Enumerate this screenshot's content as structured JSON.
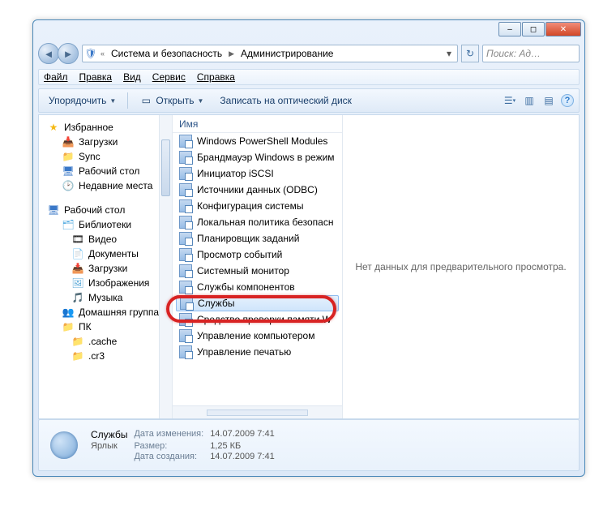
{
  "titlebar": {
    "min": "–",
    "max": "◻",
    "close": "✕"
  },
  "address": {
    "crumb1": "Система и безопасность",
    "crumb2": "Администрирование",
    "search_placeholder": "Поиск: Ад…"
  },
  "menu": {
    "file": "Файл",
    "edit": "Правка",
    "view": "Вид",
    "tools": "Сервис",
    "help": "Справка"
  },
  "toolbar": {
    "organize": "Упорядочить",
    "open": "Открыть",
    "burn": "Записать на оптический диск"
  },
  "nav": {
    "favorites": "Избранное",
    "fav_items": [
      "Загрузки",
      "Sync",
      "Рабочий стол",
      "Недавние места"
    ],
    "desktop": "Рабочий стол",
    "libraries": "Библиотеки",
    "lib_items": [
      "Видео",
      "Документы",
      "Загрузки",
      "Изображения",
      "Музыка"
    ],
    "homegroup": "Домашняя группа",
    "pc": "ПК",
    "pc_items": [
      ".cache",
      ".cr3"
    ]
  },
  "column_header": "Имя",
  "files": [
    "Windows PowerShell Modules",
    "Брандмауэр Windows в режим",
    "Инициатор iSCSI",
    "Источники данных (ODBC)",
    "Конфигурация системы",
    "Локальная политика безопасн",
    "Планировщик заданий",
    "Просмотр событий",
    "Системный монитор",
    "Службы компонентов",
    "Службы",
    "Средство проверки памяти W",
    "Управление компьютером",
    "Управление печатью"
  ],
  "selected_index": 10,
  "preview_text": "Нет данных для предварительного просмотра.",
  "details": {
    "name": "Службы",
    "type": "Ярлык",
    "mod_lbl": "Дата изменения:",
    "mod_val": "14.07.2009 7:41",
    "size_lbl": "Размер:",
    "size_val": "1,25 КБ",
    "created_lbl": "Дата создания:",
    "created_val": "14.07.2009 7:41"
  }
}
